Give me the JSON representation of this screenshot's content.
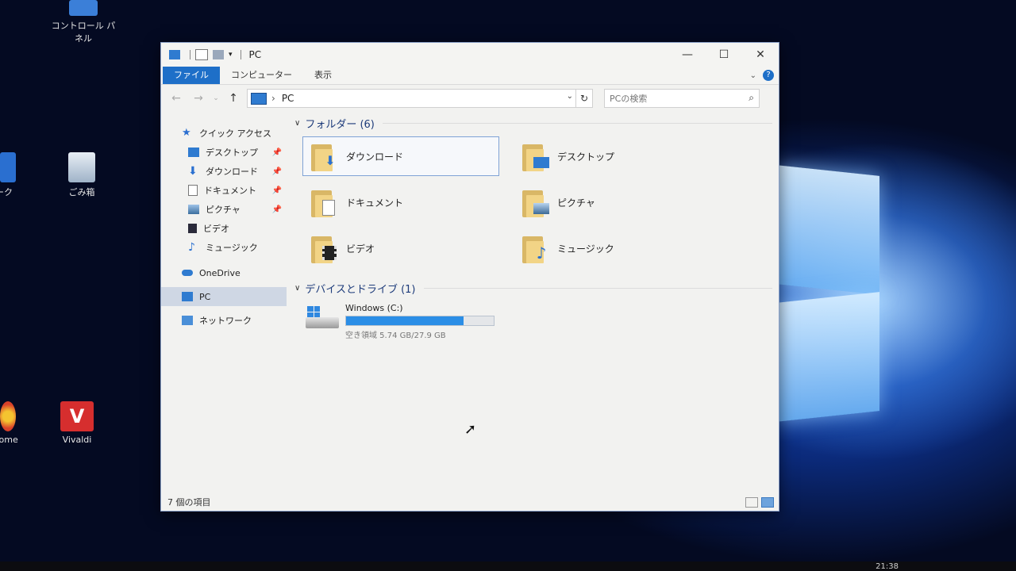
{
  "desktop": {
    "icons": [
      {
        "label": "コントロール パネル"
      },
      {
        "label": "ごみ箱"
      },
      {
        "label": "ーク"
      },
      {
        "label": "hrome"
      },
      {
        "label": "Vivaldi"
      }
    ],
    "clock": "21:38"
  },
  "window": {
    "title": "PC",
    "controls": {
      "minimize": "—",
      "maximize": "☐",
      "close": "✕"
    },
    "ribbon_tabs": [
      "ファイル",
      "コンピューター",
      "表示"
    ],
    "nav": {
      "back": "←",
      "forward": "→",
      "up": "↑"
    },
    "address": {
      "path": "PC",
      "refresh": "↻"
    },
    "search": {
      "placeholder": "PCの検索"
    },
    "navpane": {
      "quick_access": "クイック アクセス",
      "pinned": [
        "デスクトップ",
        "ダウンロード",
        "ドキュメント",
        "ピクチャ"
      ],
      "unpinned": [
        "ビデオ",
        "ミュージック"
      ],
      "onedrive": "OneDrive",
      "pc": "PC",
      "network": "ネットワーク"
    },
    "groups": {
      "folders_header": "フォルダー (6)",
      "devices_header": "デバイスとドライブ (1)"
    },
    "folders": [
      {
        "name": "ダウンロード",
        "icon": "download-arrow"
      },
      {
        "name": "デスクトップ",
        "icon": "desktop-screen"
      },
      {
        "name": "ドキュメント",
        "icon": "document-page"
      },
      {
        "name": "ピクチャ",
        "icon": "picture-landscape"
      },
      {
        "name": "ビデオ",
        "icon": "video-film"
      },
      {
        "name": "ミュージック",
        "icon": "music-note"
      }
    ],
    "drive": {
      "name": "Windows (C:)",
      "free_text": "空き領域 5.74 GB/27.9 GB",
      "used_fraction": 0.794
    },
    "status": "7 個の項目"
  },
  "colors": {
    "accent": "#1e6fc8",
    "drive_bar": "#2b8ee6"
  }
}
